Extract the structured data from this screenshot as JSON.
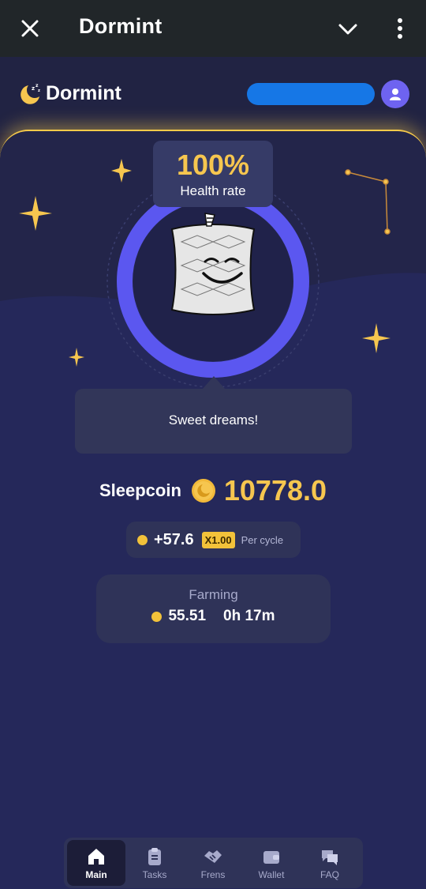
{
  "topbar": {
    "title": "Dormint",
    "icons": [
      "close-icon",
      "chevron-down-icon",
      "more-vertical-icon"
    ]
  },
  "header": {
    "brand": "Dormint",
    "logo_icon": "sleeping-moon-icon",
    "avatar_icon": "user-icon",
    "username_redacted": true
  },
  "health": {
    "value": "100%",
    "label": "Health rate",
    "fraction": 1.0
  },
  "message": "Sweet dreams!",
  "balance": {
    "label": "Sleepcoin",
    "value": "10778.0",
    "coin_icon": "moon-coin-icon"
  },
  "rate": {
    "amount": "+57.6",
    "multiplier": "X1.00",
    "period": "Per cycle"
  },
  "farming": {
    "label": "Farming",
    "amount": "55.51",
    "time": "0h 17m"
  },
  "nav": {
    "items": [
      {
        "label": "Main",
        "icon": "home-icon",
        "active": true
      },
      {
        "label": "Tasks",
        "icon": "clipboard-icon",
        "active": false
      },
      {
        "label": "Frens",
        "icon": "handshake-icon",
        "active": false
      },
      {
        "label": "Wallet",
        "icon": "wallet-icon",
        "active": false
      },
      {
        "label": "FAQ",
        "icon": "chat-bubbles-icon",
        "active": false
      }
    ]
  },
  "colors": {
    "accent": "#f6c64f",
    "ring": "#5b57f0",
    "background": "#201f40",
    "card": "#2f3358",
    "avatar": "#6e63f0"
  }
}
